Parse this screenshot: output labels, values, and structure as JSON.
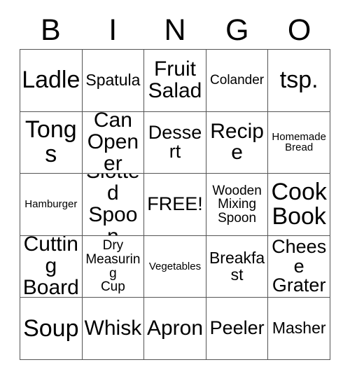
{
  "card": {
    "title_letters": [
      "B",
      "I",
      "N",
      "G",
      "O"
    ],
    "free_space_label": "FREE!",
    "border_color": "#555555",
    "text_color": "#000000",
    "background_color": "#ffffff",
    "columns": 5,
    "rows": 5,
    "cells": [
      [
        {
          "label": "Ladle",
          "size": "xxl"
        },
        {
          "label": "Spatula",
          "size": "md"
        },
        {
          "label": "Fruit\nSalad",
          "size": "xl"
        },
        {
          "label": "Colander",
          "size": "sm"
        },
        {
          "label": "tsp.",
          "size": "xxl"
        }
      ],
      [
        {
          "label": "Tongs",
          "size": "xxl"
        },
        {
          "label": "Can\nOpener",
          "size": "xl"
        },
        {
          "label": "Dessert",
          "size": "lg"
        },
        {
          "label": "Recipe",
          "size": "xl"
        },
        {
          "label": "Homemade\nBread",
          "size": "xs"
        }
      ],
      [
        {
          "label": "Hamburger",
          "size": "xs"
        },
        {
          "label": "Slotted\nSpoon",
          "size": "xl"
        },
        {
          "label": "FREE!",
          "size": "lg"
        },
        {
          "label": "Wooden\nMixing\nSpoon",
          "size": "sm"
        },
        {
          "label": "Cook\nBook",
          "size": "xxl"
        }
      ],
      [
        {
          "label": "Cutting\nBoard",
          "size": "xl"
        },
        {
          "label": "Dry\nMeasuring\nCup",
          "size": "sm"
        },
        {
          "label": "Vegetables",
          "size": "xs"
        },
        {
          "label": "Breakfast",
          "size": "md"
        },
        {
          "label": "Cheese\nGrater",
          "size": "lg"
        }
      ],
      [
        {
          "label": "Soup",
          "size": "xxl"
        },
        {
          "label": "Whisk",
          "size": "xl"
        },
        {
          "label": "Apron",
          "size": "xl"
        },
        {
          "label": "Peeler",
          "size": "lg"
        },
        {
          "label": "Masher",
          "size": "md"
        }
      ]
    ]
  }
}
